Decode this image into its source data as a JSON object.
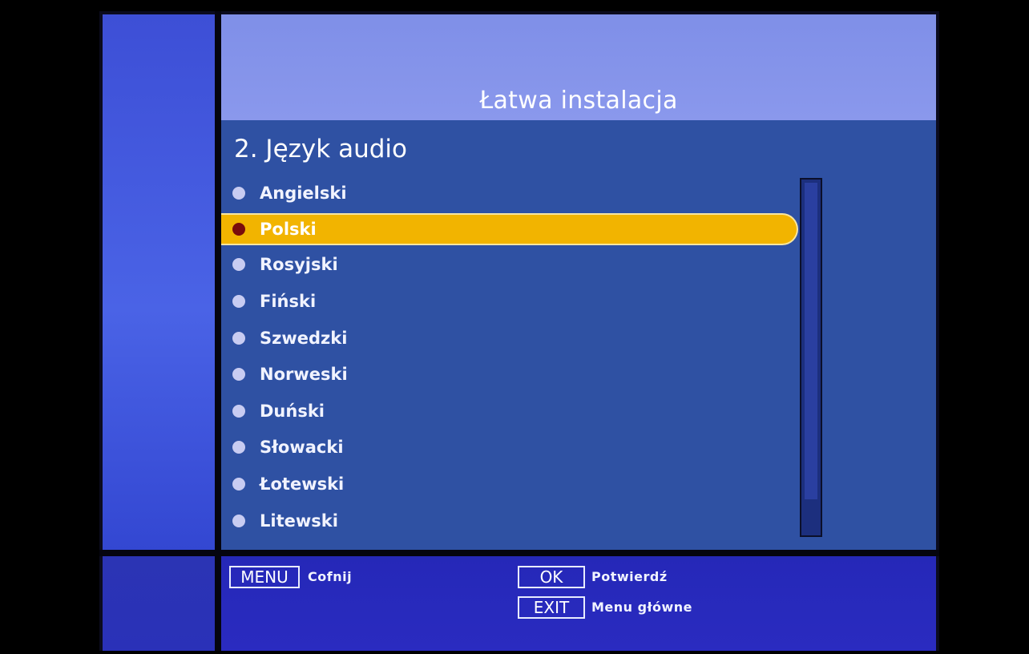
{
  "header": {
    "title": "Łatwa instalacja"
  },
  "section": {
    "title": "2. Język audio"
  },
  "languages": [
    {
      "label": "Angielski",
      "selected": false
    },
    {
      "label": "Polski",
      "selected": true
    },
    {
      "label": "Rosyjski",
      "selected": false
    },
    {
      "label": "Fiński",
      "selected": false
    },
    {
      "label": "Szwedzki",
      "selected": false
    },
    {
      "label": "Norweski",
      "selected": false
    },
    {
      "label": "Duński",
      "selected": false
    },
    {
      "label": "Słowacki",
      "selected": false
    },
    {
      "label": "Łotewski",
      "selected": false
    },
    {
      "label": "Litewski",
      "selected": false
    }
  ],
  "footer": {
    "menu_key": "MENU",
    "menu_action": "Cofnij",
    "ok_key": "OK",
    "ok_action": "Potwierdź",
    "exit_key": "EXIT",
    "exit_action": "Menu główne"
  },
  "colors": {
    "highlight": "#f2b400",
    "selected_bullet": "#7a0c0c",
    "bullet": "#c8ccf2",
    "content_bg": "#2f51a3",
    "header_bg": "#8a98ec",
    "footer_bg": "#2a2bc0"
  }
}
